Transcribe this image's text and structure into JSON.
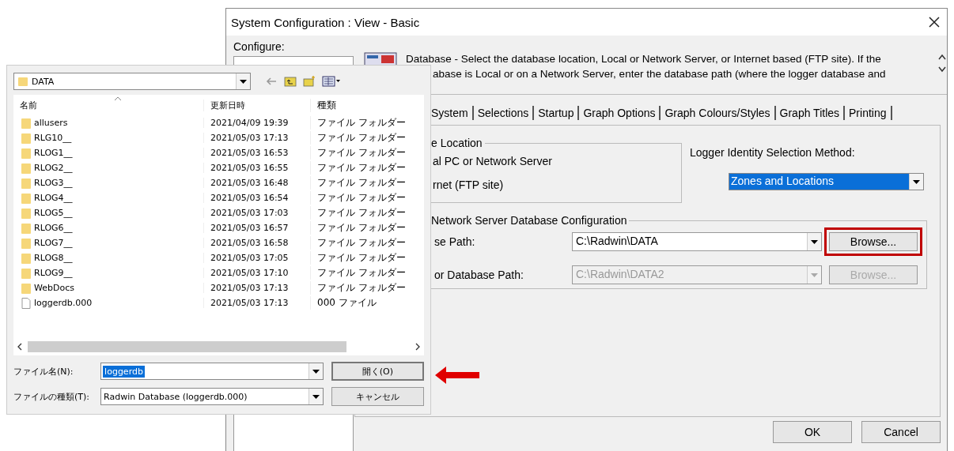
{
  "main_window": {
    "title": "System Configuration : View - Basic",
    "configure_label": "Configure:",
    "description": [
      "Database - Select the database location, Local or Network Server, or Internet based (FTP site). If the",
      "abase is Local or on a Network Server, enter the database path (where the logger database and"
    ],
    "tabs": [
      {
        "label": "System",
        "selected": false
      },
      {
        "label": "Selections",
        "selected": false
      },
      {
        "label": "Startup",
        "selected": false
      },
      {
        "label": "Graph Options",
        "selected": false
      },
      {
        "label": "Graph Colours/Styles",
        "selected": false
      },
      {
        "label": "Graph Titles",
        "selected": false
      },
      {
        "label": "Printing",
        "selected": false
      }
    ],
    "location_group": {
      "title": "e Location",
      "options": [
        "al PC or Network Server",
        "rnet (FTP site)"
      ]
    },
    "logger_identity": {
      "label": "Logger Identity Selection Method:",
      "value": "Zones and Locations",
      "value_selected": true
    },
    "network_group": {
      "title": "Network Server Database Configuration",
      "rows": [
        {
          "label": "se Path:",
          "value": "C:\\Radwin\\DATA",
          "button": "Browse...",
          "disabled": false,
          "highlighted": true
        },
        {
          "label": "or Database Path:",
          "value": "C:\\Radwin\\DATA2",
          "button": "Browse...",
          "disabled": true,
          "highlighted": false
        }
      ]
    },
    "buttons": [
      "OK",
      "Cancel"
    ]
  },
  "open_dialog": {
    "location": "DATA",
    "columns": [
      "名前",
      "更新日時",
      "種類"
    ],
    "files": [
      {
        "name": "allusers",
        "modified": "2021/04/09 19:39",
        "type": "ファイル フォルダー",
        "kind": "folder"
      },
      {
        "name": "RLG10__",
        "modified": "2021/05/03 17:13",
        "type": "ファイル フォルダー",
        "kind": "folder"
      },
      {
        "name": "RLOG1__",
        "modified": "2021/05/03 16:53",
        "type": "ファイル フォルダー",
        "kind": "folder"
      },
      {
        "name": "RLOG2__",
        "modified": "2021/05/03 16:55",
        "type": "ファイル フォルダー",
        "kind": "folder"
      },
      {
        "name": "RLOG3__",
        "modified": "2021/05/03 16:48",
        "type": "ファイル フォルダー",
        "kind": "folder"
      },
      {
        "name": "RLOG4__",
        "modified": "2021/05/03 16:54",
        "type": "ファイル フォルダー",
        "kind": "folder"
      },
      {
        "name": "RLOG5__",
        "modified": "2021/05/03 17:03",
        "type": "ファイル フォルダー",
        "kind": "folder"
      },
      {
        "name": "RLOG6__",
        "modified": "2021/05/03 16:57",
        "type": "ファイル フォルダー",
        "kind": "folder"
      },
      {
        "name": "RLOG7__",
        "modified": "2021/05/03 16:58",
        "type": "ファイル フォルダー",
        "kind": "folder"
      },
      {
        "name": "RLOG8__",
        "modified": "2021/05/03 17:05",
        "type": "ファイル フォルダー",
        "kind": "folder"
      },
      {
        "name": "RLOG9__",
        "modified": "2021/05/03 17:10",
        "type": "ファイル フォルダー",
        "kind": "folder"
      },
      {
        "name": "WebDocs",
        "modified": "2021/05/03 17:13",
        "type": "ファイル フォルダー",
        "kind": "folder"
      },
      {
        "name": "loggerdb.000",
        "modified": "2021/05/03 17:13",
        "type": "000 ファイル",
        "kind": "file"
      }
    ],
    "file_name_label": "ファイル名(N):",
    "file_name": "loggerdb",
    "file_name_selected": true,
    "file_type_label": "ファイルの種類(T):",
    "file_type": "Radwin Database (loggerdb.000)",
    "buttons": [
      "開く(O)",
      "キャンセル"
    ],
    "pointer_arrow": true
  }
}
